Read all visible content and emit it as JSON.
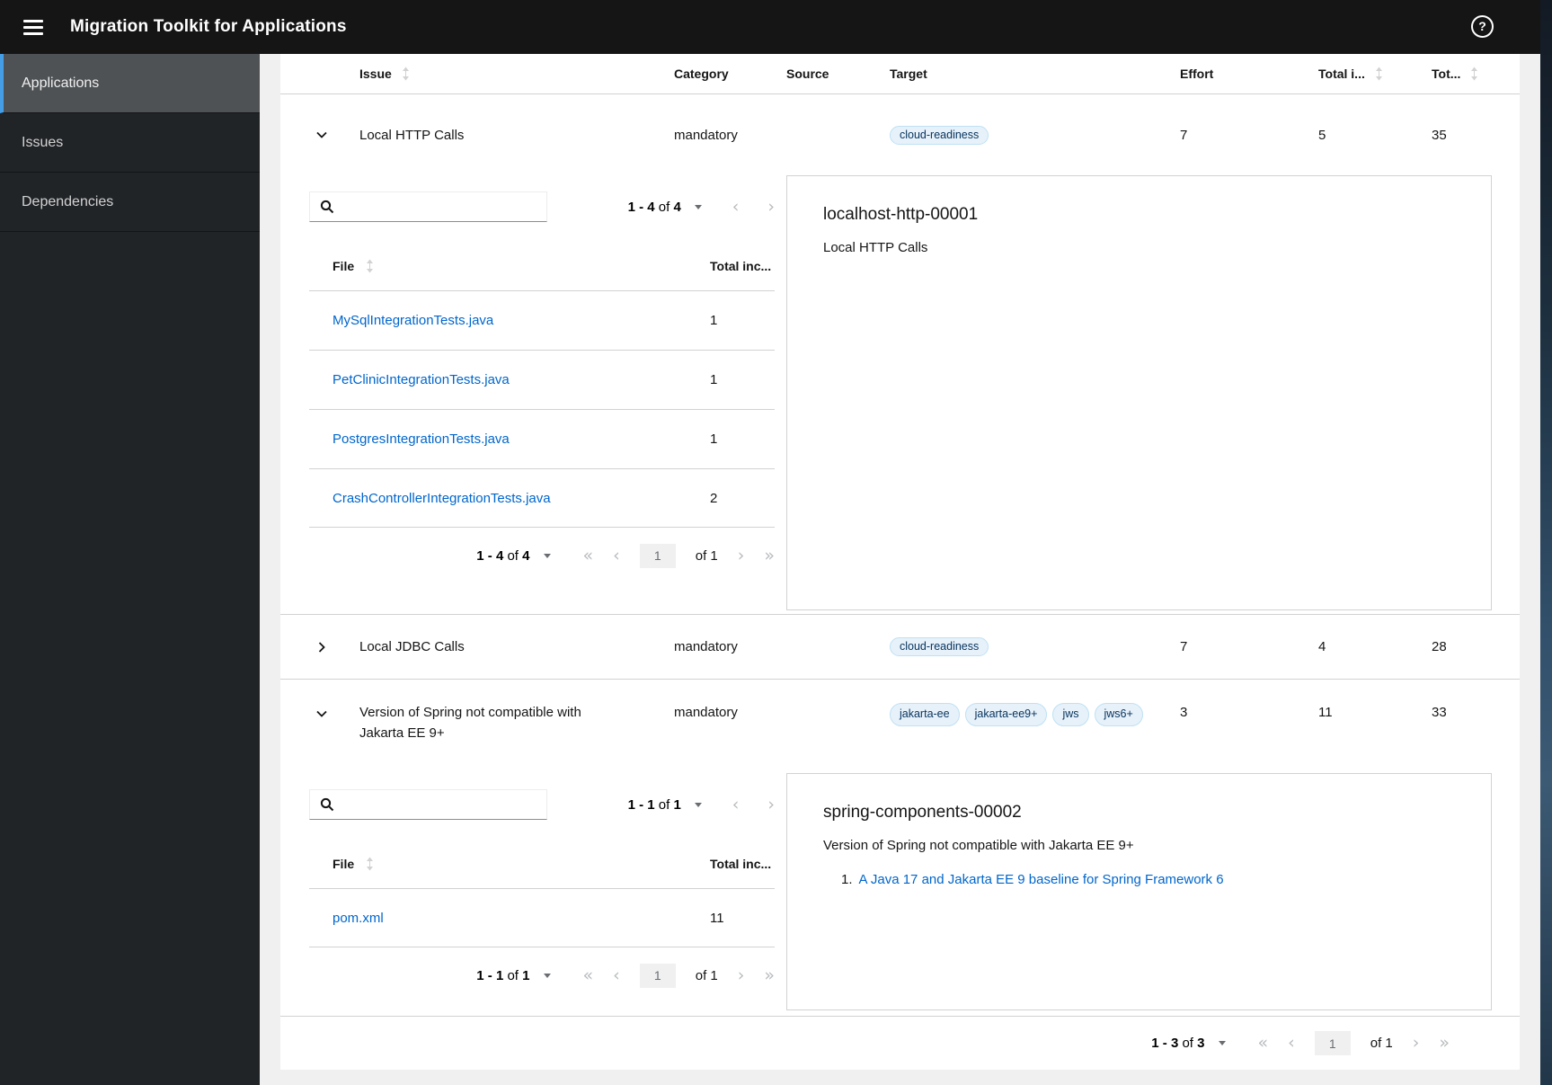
{
  "masthead": {
    "title": "Migration Toolkit for Applications"
  },
  "icons": {
    "help": "?",
    "pagination_first": "«",
    "pagination_prev": "‹",
    "pagination_next": "›",
    "pagination_last": "»"
  },
  "colors": {
    "masthead_bg": "#151515",
    "sidebar_bg": "#212427",
    "selected_item_bg": "#4f5255",
    "selected_item_border": "#459ee5",
    "link": "#0066cc",
    "tag_bg": "#e7f1fa",
    "tag_border": "#bee1f4",
    "separator": "#d2d2d2"
  },
  "sidebar": {
    "items": [
      {
        "label": "Applications",
        "selected": true
      },
      {
        "label": "Issues",
        "selected": false
      },
      {
        "label": "Dependencies",
        "selected": false
      }
    ]
  },
  "table": {
    "columns": {
      "issue": "Issue",
      "category": "Category",
      "source": "Source",
      "target": "Target",
      "effort": "Effort",
      "total_incidents": "Total i...",
      "total_storypoints": "Tot..."
    },
    "rows": [
      {
        "issue": "Local HTTP Calls",
        "category": "mandatory",
        "source": "",
        "targets": [
          "cloud-readiness"
        ],
        "effort": "7",
        "total_incidents": "5",
        "total_storypoints": "35",
        "expanded": true
      },
      {
        "issue": "Local JDBC Calls",
        "category": "mandatory",
        "source": "",
        "targets": [
          "cloud-readiness"
        ],
        "effort": "7",
        "total_incidents": "4",
        "total_storypoints": "28",
        "expanded": false
      },
      {
        "issue": "Version of Spring not compatible with Jakarta EE 9+",
        "category": "mandatory",
        "source": "",
        "targets": [
          "jakarta-ee",
          "jakarta-ee9+",
          "jws",
          "jws6+"
        ],
        "effort": "3",
        "total_incidents": "11",
        "total_storypoints": "33",
        "expanded": true
      }
    ]
  },
  "panel1": {
    "search": {
      "value": ""
    },
    "top_pagination": {
      "range": "1 - 4",
      "of": "of",
      "total": "4"
    },
    "file_table": {
      "columns": {
        "file": "File",
        "incidents": "Total inc..."
      },
      "rows": [
        {
          "file": "MySqlIntegrationTests.java",
          "incidents": "1"
        },
        {
          "file": "PetClinicIntegrationTests.java",
          "incidents": "1"
        },
        {
          "file": "PostgresIntegrationTests.java",
          "incidents": "1"
        },
        {
          "file": "CrashControllerIntegrationTests.java",
          "incidents": "2"
        }
      ]
    },
    "bottom_pagination": {
      "range": "1 - 4",
      "of": "of",
      "total": "4",
      "page": "1",
      "of_pages": "of 1"
    },
    "detail": {
      "title": "localhost-http-00001",
      "description": "Local HTTP Calls"
    }
  },
  "panel2": {
    "search": {
      "value": ""
    },
    "top_pagination": {
      "range": "1 - 1",
      "of": "of",
      "total": "1"
    },
    "file_table": {
      "columns": {
        "file": "File",
        "incidents": "Total inc..."
      },
      "rows": [
        {
          "file": "pom.xml",
          "incidents": "11"
        }
      ]
    },
    "bottom_pagination": {
      "range": "1 - 1",
      "of": "of",
      "total": "1",
      "page": "1",
      "of_pages": "of 1"
    },
    "detail": {
      "title": "spring-components-00002",
      "description": "Version of Spring not compatible with Jakarta EE 9+",
      "links": [
        {
          "index": "1.",
          "text": "A Java 17 and Jakarta EE 9 baseline for Spring Framework 6"
        }
      ]
    }
  },
  "footer_pagination": {
    "range": "1 - 3",
    "of": "of",
    "total": "3",
    "page": "1",
    "of_pages": "of 1"
  }
}
